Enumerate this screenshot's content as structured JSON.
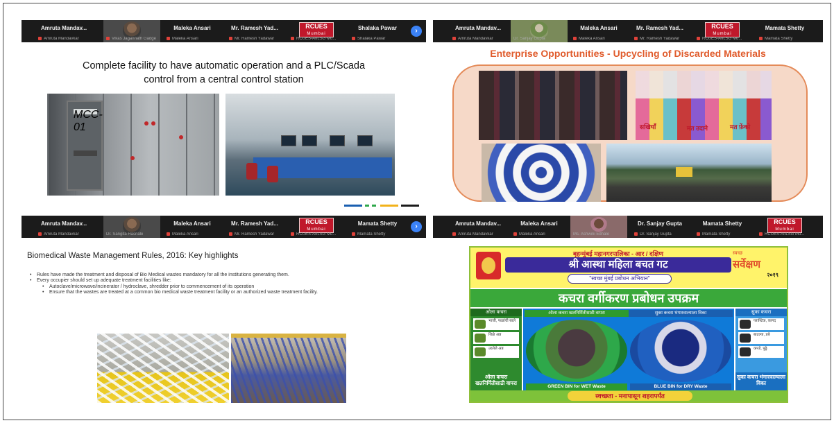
{
  "panels": [
    {
      "participants": [
        {
          "name": "Amruta  Mandav...",
          "label": "Amruta Mandavkar",
          "type": "name"
        },
        {
          "name": "",
          "label": "Vikas Jagannath Gadge",
          "type": "video"
        },
        {
          "name": "Maleka Ansari",
          "label": "Maleka Ansari",
          "type": "name"
        },
        {
          "name": "Mr. Ramesh Yad...",
          "label": "Mr. Ramesh Yadawar",
          "type": "name"
        },
        {
          "name": "RCUES",
          "sub": "Mumbai",
          "label": "RCUES-AIILSG Mu...",
          "type": "logo"
        },
        {
          "name": "Shalaka Pawar",
          "label": "Shalaka Pawar",
          "type": "name"
        }
      ],
      "heading": [
        "Complete facility to have automatic operation and a PLC/Scada",
        "control from a central control station"
      ],
      "cabinet_tag": "MCC-01"
    },
    {
      "participants": [
        {
          "name": "Amruta  Mandav...",
          "label": "Amruta Mandavkar",
          "type": "name"
        },
        {
          "name": "",
          "label": "Dr. Sanjay Gupta",
          "type": "video"
        },
        {
          "name": "Maleka Ansari",
          "label": "Maleka Ansari",
          "type": "name"
        },
        {
          "name": "Mr. Ramesh Yad...",
          "label": "Mr. Ramesh Yadawar",
          "type": "name"
        },
        {
          "name": "RCUES",
          "sub": "Mumbai",
          "label": "RCUES-AIILSG Mu...",
          "type": "logo"
        },
        {
          "name": "Mamata Shetty",
          "label": "Mamata Shetty",
          "type": "name"
        }
      ],
      "heading": "Enterprise Opportunities - Upcycling of Discarded Materials",
      "patch_text": [
        "सखियाँ",
        "मत उदाने",
        "मत फ़ेंको"
      ]
    },
    {
      "participants": [
        {
          "name": "Amruta  Mandav...",
          "label": "Amruta Mandavkar",
          "type": "name"
        },
        {
          "name": "",
          "label": "Dr. Sangita Hasnale",
          "type": "video"
        },
        {
          "name": "Maleka Ansari",
          "label": "Maleka Ansari",
          "type": "name"
        },
        {
          "name": "Mr. Ramesh Yad...",
          "label": "Mr. Ramesh Yadawar",
          "type": "name"
        },
        {
          "name": "RCUES",
          "sub": "Mumbai",
          "label": "RCUES-AIILSG Mu...",
          "type": "logo"
        },
        {
          "name": "Mamata Shetty",
          "label": "Mamata Shetty",
          "type": "name"
        }
      ],
      "heading": "Biomedical Waste Management Rules, 2016: Key highlights",
      "bullets": [
        {
          "level": 1,
          "text": "Rules have made the treatment and disposal of Bio Medical wastes mandatory for all the institutions generating them."
        },
        {
          "level": 1,
          "text": "Every occupier should set up adequate treatment facilities like:"
        },
        {
          "level": 2,
          "text": "Autoclave/microwave/incinerator / hydroclave, shredder prior to commencement of its operation"
        },
        {
          "level": 2,
          "text": "Ensure that the wastes are treated at a common bio medical waste treatment facility or an authorized waste treatment facility."
        }
      ]
    },
    {
      "participants": [
        {
          "name": "Amruta  Mandav...",
          "label": "Amruta Mandavkar",
          "type": "name"
        },
        {
          "name": "Maleka Ansari",
          "label": "Maleka Ansari",
          "type": "name"
        },
        {
          "name": "",
          "label": "Ms. Ashwini Ednale",
          "type": "video"
        },
        {
          "name": "Dr. Sanjay Gupta",
          "label": "Dr. Sanjay Gupta",
          "type": "name"
        },
        {
          "name": "Mamata Shetty",
          "label": "Mamata Shetty",
          "type": "name"
        },
        {
          "name": "RCUES",
          "sub": "Mumbai",
          "label": "RCUES-AIILSG Mu...",
          "type": "logo"
        }
      ],
      "poster": {
        "line1": "बृहन्मुंबई महानगरपालिका - आर / दक्षिण",
        "line2": "श्री आस्था महिला बचत गट",
        "line3": "\"स्वच्छ मुंबई प्रबोधन अभियान\"",
        "badge_top": "स्वच्छ",
        "badge_main": "सर्वेक्षण",
        "badge_year": "२०१९",
        "band": "कचरा वर्गीकरण प्रबोधन उपक्रम",
        "wet_header": "ओला कचरा",
        "wet_items": [
          "भाजी, फळांची साले",
          "शिळे अन्न",
          "उरलेले अन्न"
        ],
        "wet_footer": "ओला कचरा खतनिर्मितीसाठी वापरा",
        "bin_left_header": "ओला कचरा खतनिर्मितीसाठी वापरा",
        "bin_right_header": "सुका कचरा भंगारवाल्याला विका",
        "green_bin_label": "GREEN BIN for WET Waste",
        "blue_bin_label": "BLUE BIN for DRY Waste",
        "dry_header": "सुका कचरा",
        "dry_items": [
          "प्लास्टिक, कागद",
          "बाटल्या, डबे",
          "कपडे, पुठ्ठे"
        ],
        "dry_footer": "सुका कचरा भंगारवाल्याला विका",
        "footer": "स्वच्छता - मनापासून शहरापर्यंत"
      }
    }
  ],
  "colors": {
    "meeting_bar": "#1b1b1b",
    "rcues_red": "#c0182b",
    "heading_orange": "#e05a2a",
    "poster_green": "#3aa83a",
    "next_button": "#3b82f6"
  },
  "icons": {
    "next": "chevron-right-icon",
    "mic": "mic-muted-icon"
  }
}
